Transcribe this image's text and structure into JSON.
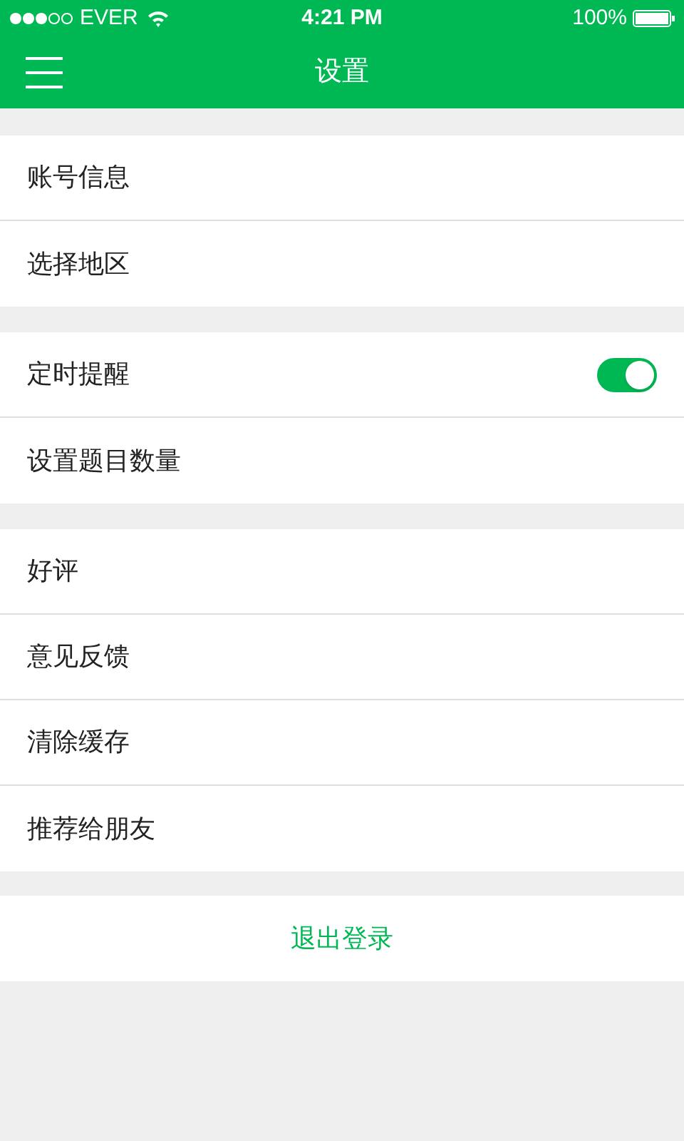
{
  "status_bar": {
    "carrier": "EVER",
    "time": "4:21 PM",
    "battery": "100%"
  },
  "nav": {
    "title": "设置"
  },
  "groups": [
    {
      "items": [
        {
          "kind": "link",
          "label": "账号信息"
        },
        {
          "kind": "link",
          "label": "选择地区"
        }
      ]
    },
    {
      "items": [
        {
          "kind": "toggle",
          "label": "定时提醒",
          "on": true
        },
        {
          "kind": "link",
          "label": "设置题目数量"
        }
      ]
    },
    {
      "items": [
        {
          "kind": "link",
          "label": "好评"
        },
        {
          "kind": "link",
          "label": "意见反馈"
        },
        {
          "kind": "link",
          "label": "清除缓存"
        },
        {
          "kind": "link",
          "label": "推荐给朋友"
        }
      ]
    }
  ],
  "logout_button": "退出登录"
}
